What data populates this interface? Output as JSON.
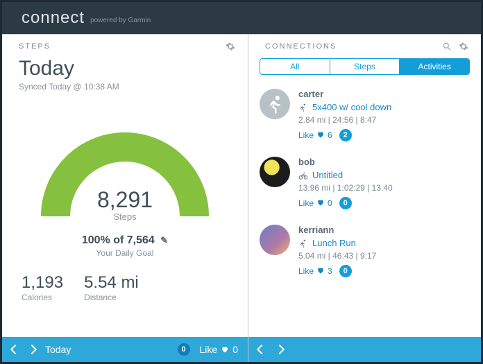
{
  "brand": {
    "logo": "connect",
    "powered": "powered by Garmin"
  },
  "steps": {
    "card_title": "STEPS",
    "title": "Today",
    "synced": "Synced Today @ 10:38 AM",
    "count": "8,291",
    "count_label": "Steps",
    "goal_line": "100% of 7,564",
    "goal_sub": "Your Daily Goal",
    "calories": {
      "value": "1,193",
      "label": "Calories"
    },
    "distance": {
      "value": "5.54 mi",
      "label": "Distance"
    }
  },
  "steps_footer": {
    "label": "Today",
    "comments": "0",
    "like_label": "Like",
    "like_count": "0"
  },
  "connections": {
    "card_title": "CONNECTIONS",
    "tabs": {
      "all": "All",
      "steps": "Steps",
      "activities": "Activities"
    },
    "items": [
      {
        "user": "carter",
        "icon": "running-icon",
        "activity": "5x400 w/ cool down",
        "stats": "2.84 mi | 24:56 | 8:47",
        "like_label": "Like",
        "like_count": "6",
        "comments": "2"
      },
      {
        "user": "bob",
        "icon": "cycling-icon",
        "activity": "Untitled",
        "stats": "13.96 mi | 1:02:29 | 13.40",
        "like_label": "Like",
        "like_count": "0",
        "comments": "0"
      },
      {
        "user": "kerriann",
        "icon": "running-icon",
        "activity": "Lunch Run",
        "stats": "5.04 mi | 46:43 | 9:17",
        "like_label": "Like",
        "like_count": "3",
        "comments": "0"
      }
    ]
  }
}
